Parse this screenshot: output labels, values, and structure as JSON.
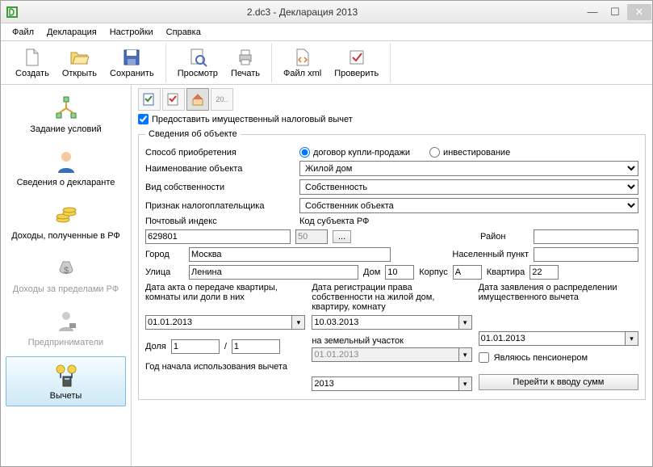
{
  "window": {
    "title": "2.dc3 - Декларация 2013"
  },
  "menu": {
    "file": "Файл",
    "decl": "Декларация",
    "settings": "Настройки",
    "help": "Справка"
  },
  "tb": {
    "create": "Создать",
    "open": "Открыть",
    "save": "Сохранить",
    "preview": "Просмотр",
    "print": "Печать",
    "xml": "Файл xml",
    "check": "Проверить"
  },
  "side": {
    "cond": "Задание условий",
    "decl": "Сведения о декларанте",
    "income_rf": "Доходы, полученные в РФ",
    "income_abroad": "Доходы за пределами РФ",
    "entr": "Предприниматели",
    "deduct": "Вычеты"
  },
  "mini_doc": "20..",
  "main_check": "Предоставить имущественный налоговый вычет",
  "fs_title": "Сведения об объекте",
  "labels": {
    "acq": "Способ приобретения",
    "acq_sale": "договор купли-продажи",
    "acq_inv": "инвестирование",
    "obj_name": "Наименование объекта",
    "own_type": "Вид собственности",
    "taxpayer": "Признак налогоплательщика",
    "post": "Почтовый индекс",
    "subj": "Код субъекта РФ",
    "subj_btn": "...",
    "district": "Район",
    "city": "Город",
    "town": "Населенный пункт",
    "street": "Улица",
    "house": "Дом",
    "block": "Корпус",
    "flat": "Квартира",
    "date_act": "Дата акта о передаче квартиры, комнаты или доли в них",
    "date_reg": "Дата регистрации права собственности на жилой дом, квартиру, комнату",
    "date_land": "на земельный участок",
    "date_app": "Дата заявления о распределении имущественного вычета",
    "share": "Доля",
    "share_sep": "/",
    "pension": "Являюсь пенсионером",
    "year_start": "Год начала использования вычета",
    "go_btn": "Перейти к вводу сумм"
  },
  "values": {
    "obj_name": "Жилой дом",
    "own_type": "Собственность",
    "taxpayer": "Собственник объекта",
    "post": "629801",
    "subj": "50",
    "district": "",
    "city": "Москва",
    "town": "",
    "street": "Ленина",
    "house": "10",
    "block": "А",
    "flat": "22",
    "date_act": "01.01.2013",
    "date_reg": "10.03.2013",
    "date_land": "01.01.2013",
    "date_app": "01.01.2013",
    "share_n": "1",
    "share_d": "1",
    "year_start": "2013"
  }
}
